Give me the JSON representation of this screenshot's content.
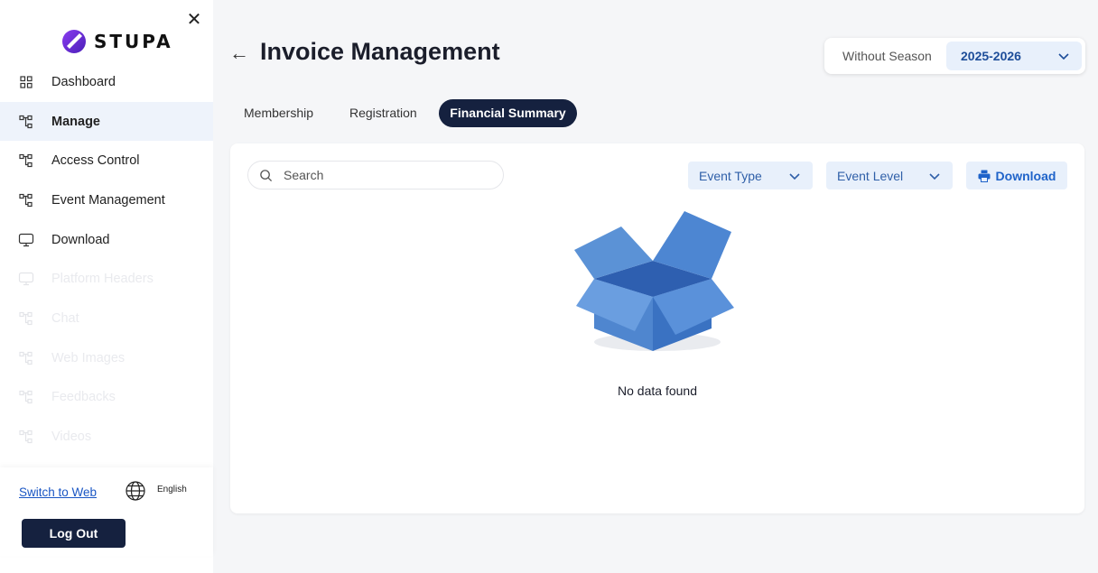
{
  "sidebar": {
    "brand": "STUPA",
    "items": [
      {
        "label": "Dashboard"
      },
      {
        "label": "Manage"
      },
      {
        "label": "Access Control"
      },
      {
        "label": "Event Management"
      },
      {
        "label": "Download"
      },
      {
        "label": "Platform Headers"
      },
      {
        "label": "Chat"
      },
      {
        "label": "Web Images"
      },
      {
        "label": "Feedbacks"
      },
      {
        "label": "Videos"
      }
    ],
    "switch_label": "Switch to Web",
    "language": "English",
    "logout_label": "Log Out"
  },
  "header": {
    "title": "Invoice Management",
    "season_label": "Without Season",
    "season_value": "2025-2026"
  },
  "tabs": [
    {
      "label": "Membership"
    },
    {
      "label": "Registration"
    },
    {
      "label": "Financial Summary"
    }
  ],
  "toolbar": {
    "search_placeholder": "Search",
    "event_type_label": "Event Type",
    "event_level_label": "Event Level",
    "download_label": "Download"
  },
  "empty_state": {
    "message": "No data found"
  },
  "colors": {
    "brand_logo": "#6a2bd9",
    "primary_dark": "#15213f",
    "accent_light": "#e8f0fb",
    "link": "#1a56c4"
  }
}
